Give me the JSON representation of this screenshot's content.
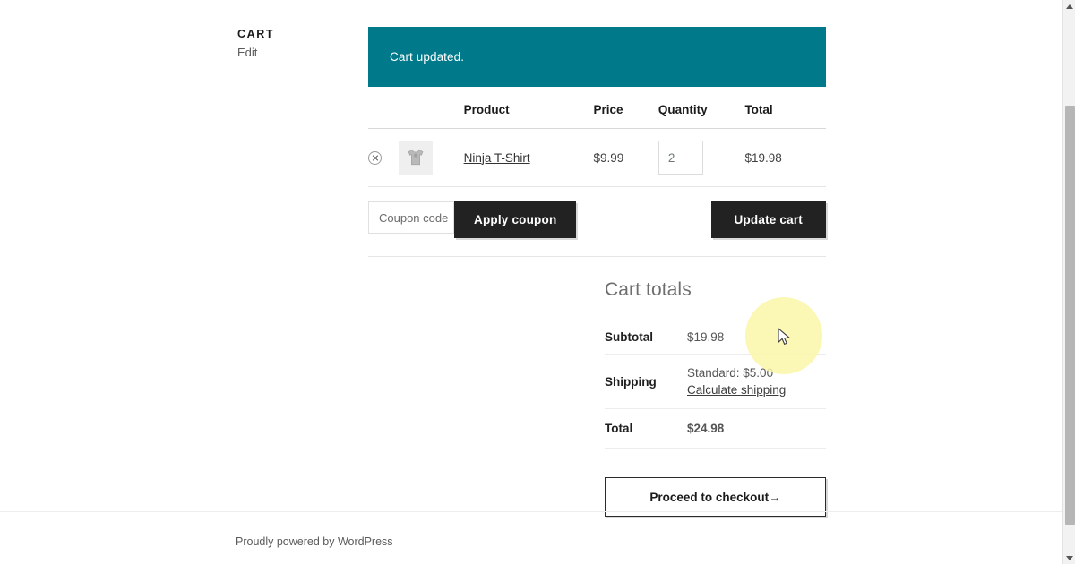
{
  "sidebar": {
    "title": "CART",
    "edit_label": "Edit"
  },
  "notice": {
    "message": "Cart updated.",
    "background_color": "#00798a"
  },
  "cart_table": {
    "headers": {
      "remove": "",
      "thumbnail": "",
      "product": "Product",
      "price": "Price",
      "quantity": "Quantity",
      "total": "Total"
    },
    "rows": [
      {
        "remove_icon": "remove-item-icon",
        "thumbnail_icon": "tshirt-thumbnail",
        "product_name": "Ninja T-Shirt",
        "price": "$9.99",
        "quantity": "2",
        "line_total": "$19.98"
      }
    ]
  },
  "actions": {
    "coupon_placeholder": "Coupon code",
    "coupon_value": "",
    "apply_coupon_label": "Apply coupon",
    "update_cart_label": "Update cart"
  },
  "cart_totals": {
    "title": "Cart totals",
    "subtotal_label": "Subtotal",
    "subtotal_value": "$19.98",
    "shipping_label": "Shipping",
    "shipping_method": "Standard: $5.00",
    "calculate_shipping_label": "Calculate shipping",
    "total_label": "Total",
    "total_value": "$24.98",
    "checkout_label": "Proceed to checkout→"
  },
  "footer": {
    "credit": "Proudly powered by WordPress"
  },
  "cursor": {
    "highlight_color": "#faf6a8",
    "x": "873",
    "y": "375"
  }
}
